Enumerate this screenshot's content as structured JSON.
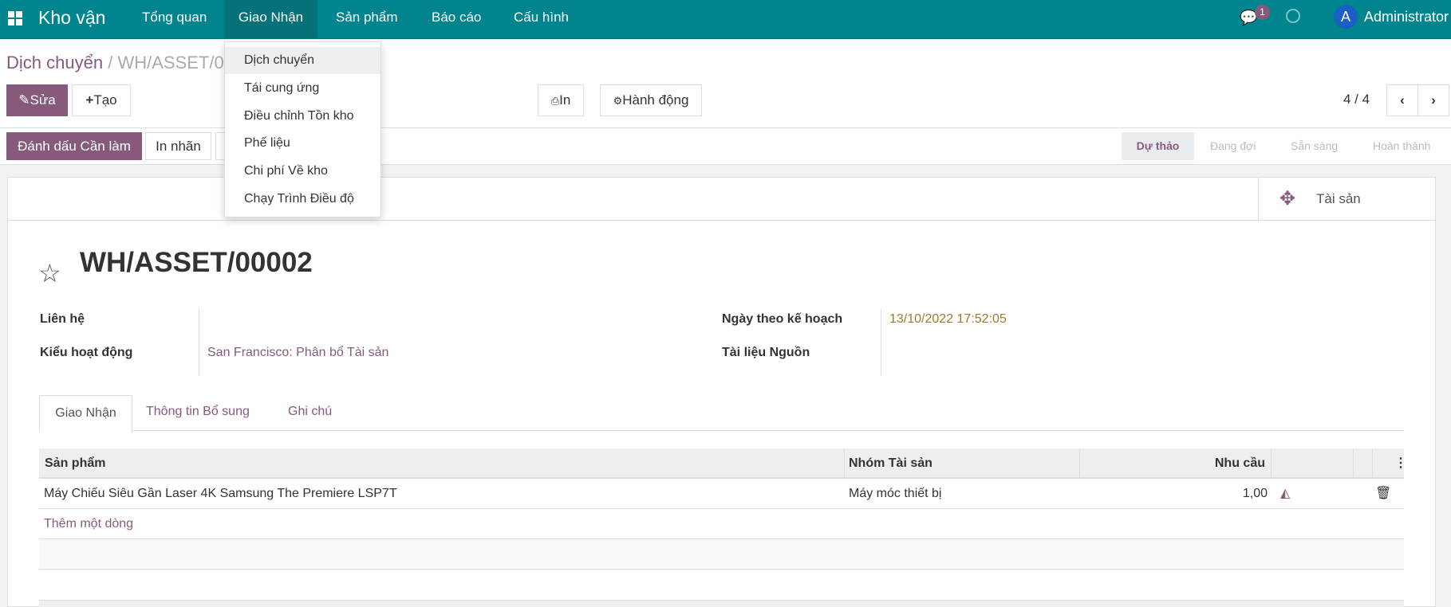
{
  "navbar": {
    "brand": "Kho vận",
    "menu": [
      "Tổng quan",
      "Giao Nhận",
      "Sản phẩm",
      "Báo cáo",
      "Cấu hình"
    ],
    "message_count": "1",
    "user_initial": "A",
    "user": "Administrator"
  },
  "dropdown": {
    "items": [
      "Dịch chuyển",
      "Tái cung ứng",
      "Điều chỉnh Tồn kho",
      "Phế liệu",
      "Chi phí Về kho",
      "Chạy Trình Điều độ"
    ]
  },
  "breadcrumb": {
    "parent": "Dịch chuyển",
    "current": "WH/ASSET/00002"
  },
  "toolbar": {
    "edit": "Sửa",
    "create": "Tạo",
    "print": "In",
    "action": "Hành động",
    "pager": "4 / 4"
  },
  "header_buttons": {
    "mark_todo": "Đánh dấu Cần làm",
    "print_labels": "In nhãn"
  },
  "statusbar": [
    "Dự thảo",
    "Đang đợi",
    "Sẵn sàng",
    "Hoàn thành"
  ],
  "button_box": {
    "assets": "Tài sản"
  },
  "record": {
    "name": "WH/ASSET/00002",
    "fields": {
      "partner_label": "Liên hệ",
      "partner": "",
      "op_type_label": "Kiểu hoạt động",
      "op_type": "San Francisco: Phân bổ Tài sản",
      "date_label": "Ngày theo kế hoạch",
      "date": "13/10/2022 17:52:05",
      "origin_label": "Tài liệu Nguồn",
      "origin": ""
    }
  },
  "tabs": [
    "Giao Nhận",
    "Thông tin Bổ sung",
    "Ghi chú"
  ],
  "table": {
    "columns": [
      "Sản phẩm",
      "Nhóm Tài sản",
      "Nhu cầu"
    ],
    "rows": [
      {
        "product": "Máy Chiếu Siêu Gần Laser 4K Samsung The Premiere LSP7T",
        "group": "Máy móc thiết bị",
        "qty": "1,00"
      }
    ],
    "add_line": "Thêm một dòng"
  },
  "colors": {
    "navbar": "#00858f",
    "primary": "#875A7B",
    "date": "#a07828"
  }
}
